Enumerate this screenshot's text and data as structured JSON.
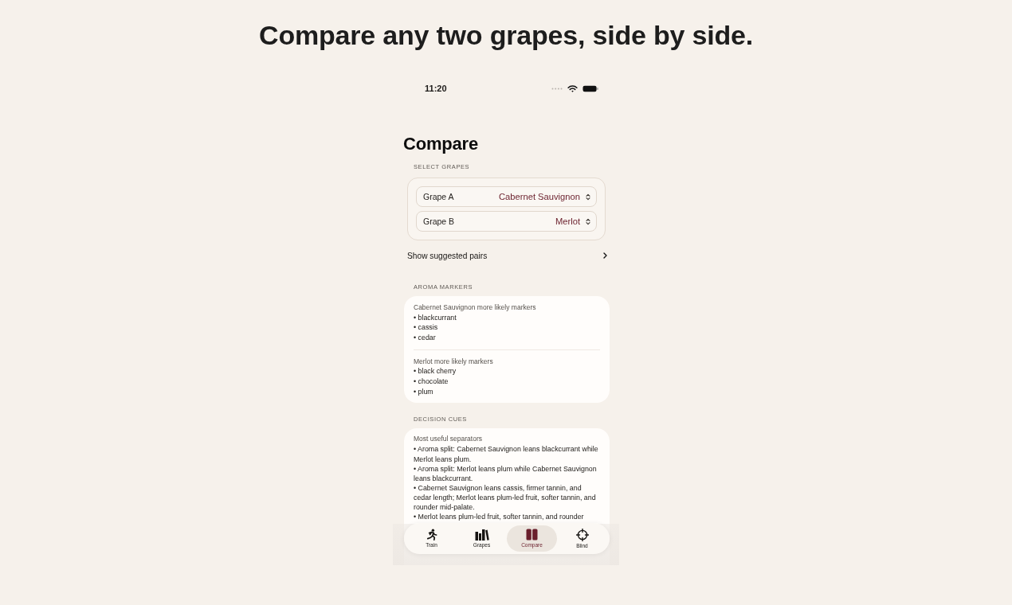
{
  "headline": "Compare any two grapes, side by side.",
  "status_bar": {
    "time": "11:20"
  },
  "screen": {
    "title": "Compare"
  },
  "select_grapes": {
    "heading": "SELECT GRAPES",
    "pickers": [
      {
        "label": "Grape A",
        "value": "Cabernet Sauvignon"
      },
      {
        "label": "Grape B",
        "value": "Merlot"
      }
    ]
  },
  "suggested_pairs": {
    "label": "Show suggested pairs"
  },
  "aroma_markers": {
    "heading": "AROMA MARKERS",
    "groups": [
      {
        "title": "Cabernet Sauvignon more likely markers",
        "items": [
          "• blackcurrant",
          "• cassis",
          "• cedar"
        ]
      },
      {
        "title": "Merlot more likely markers",
        "items": [
          "• black cherry",
          "• chocolate",
          "• plum"
        ]
      }
    ]
  },
  "decision_cues": {
    "heading": "DECISION CUES",
    "title": "Most useful separators",
    "items": [
      "• Aroma split: Cabernet Sauvignon leans blackcurrant while Merlot leans plum.",
      "• Aroma split: Merlot leans plum while Cabernet Sauvignon leans blackcurrant.",
      "• Cabernet Sauvignon leans cassis, firmer tannin, and cedar length; Merlot leans plum-led fruit, softer tannin, and rounder mid-palate.",
      "• Merlot leans plum-led fruit, softer tannin, and rounder"
    ]
  },
  "tab_bar": [
    {
      "label": "Train",
      "selected": false
    },
    {
      "label": "Grapes",
      "selected": false
    },
    {
      "label": "Compare",
      "selected": true
    },
    {
      "label": "Blind",
      "selected": false
    }
  ]
}
